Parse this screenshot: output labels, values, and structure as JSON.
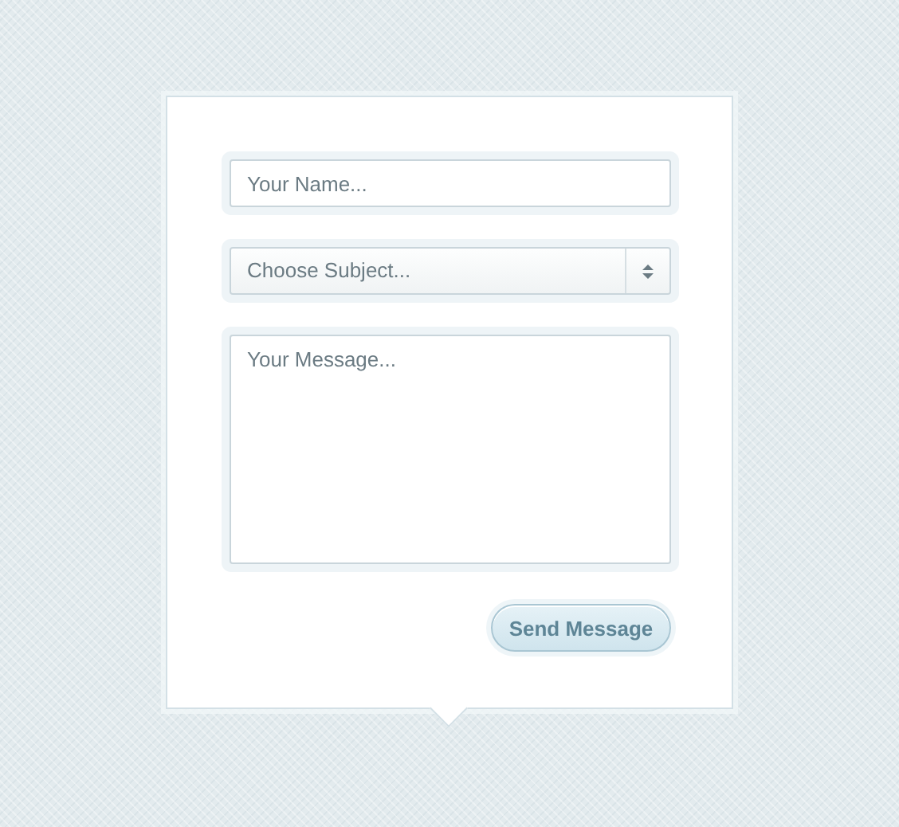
{
  "form": {
    "name_field": {
      "placeholder": "Your Name..."
    },
    "subject_select": {
      "placeholder": "Choose Subject..."
    },
    "message_field": {
      "placeholder": "Your Message..."
    },
    "submit_button": {
      "label": "Send Message"
    }
  }
}
